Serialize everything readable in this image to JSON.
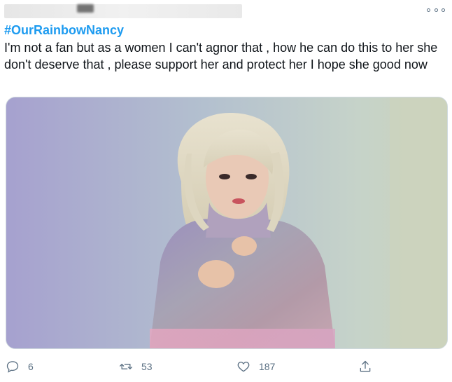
{
  "tweet": {
    "hashtag": "#OurRainbowNancy",
    "text": "I'm not a fan but as a women I can't agnor that , how he can do this to her she don't deserve that , please support her and protect her I hope she good now",
    "more_icon": "more-horizontal-icon"
  },
  "media": {
    "image_alt": "photo"
  },
  "actions": {
    "reply_count": "6",
    "retweet_count": "53",
    "like_count": "187",
    "icons": [
      "reply-icon",
      "retweet-icon",
      "like-icon",
      "share-icon"
    ]
  },
  "colors": {
    "link": "#1d9bf0",
    "text": "#0f1419",
    "muted": "#5b7083",
    "border": "#cfd9de"
  }
}
